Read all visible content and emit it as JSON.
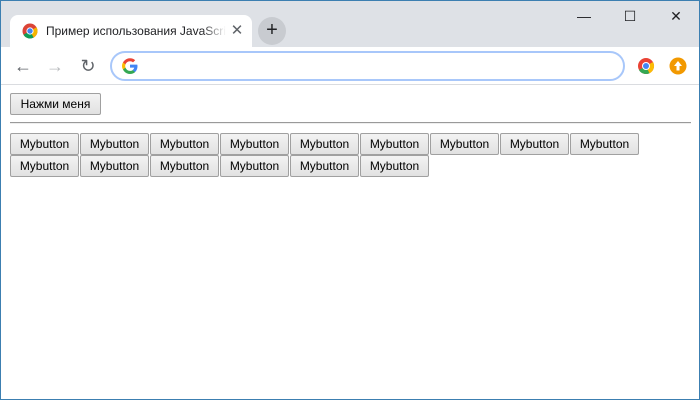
{
  "browser": {
    "tab_title": "Пример использования JavaScript",
    "tab_close_glyph": "✕",
    "new_tab_glyph": "+",
    "window_controls": {
      "minimize": "—",
      "maximize": "☐",
      "close": "✕"
    },
    "nav": {
      "back": "←",
      "forward": "→",
      "reload": "↻"
    },
    "address_value": "",
    "icons": [
      "chrome-favicon",
      "google-g-icon",
      "extension-colorful-icon",
      "extension-orange-upload-icon"
    ],
    "accent_colors": {
      "address_focus": "#a8c7fa",
      "tabstrip": "#dee1e6",
      "ext_orange": "#f29900"
    }
  },
  "page": {
    "main_button_label": "Нажми меня",
    "buttons": [
      "Mybutton",
      "Mybutton",
      "Mybutton",
      "Mybutton",
      "Mybutton",
      "Mybutton",
      "Mybutton",
      "Mybutton",
      "Mybutton",
      "Mybutton",
      "Mybutton",
      "Mybutton",
      "Mybutton",
      "Mybutton",
      "Mybutton"
    ]
  }
}
